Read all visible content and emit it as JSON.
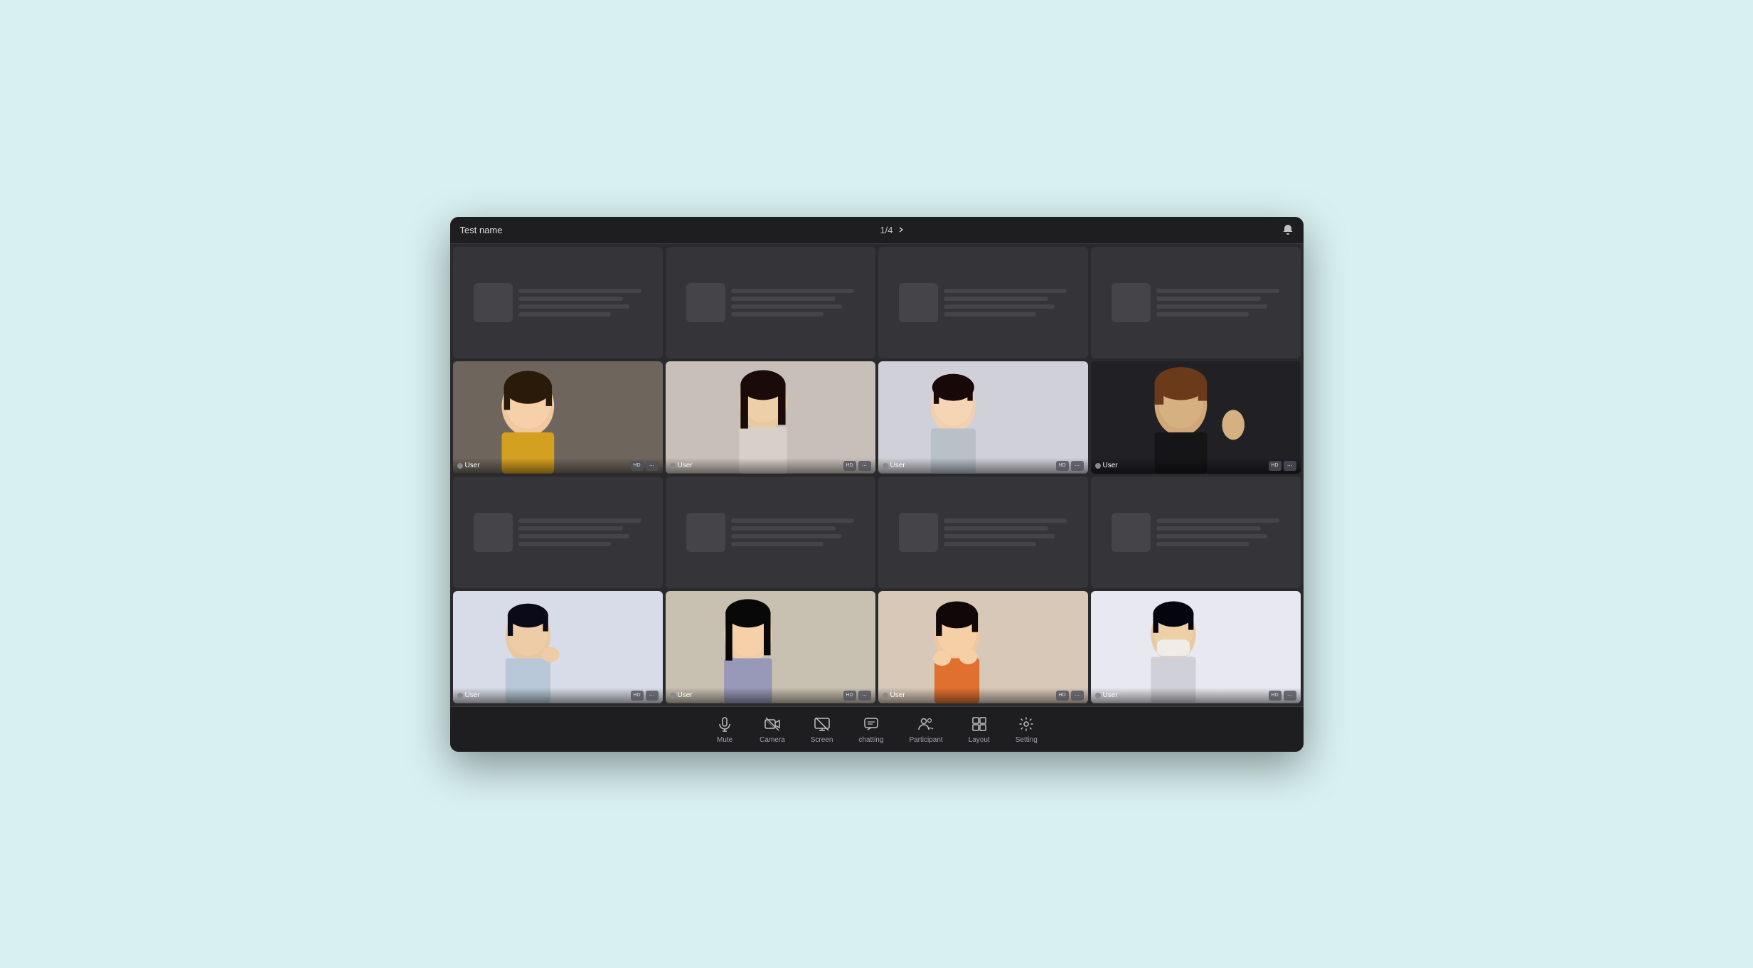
{
  "window": {
    "title": "Test name",
    "pagination": "1/4",
    "notification_icon": "🔔"
  },
  "grid": {
    "rows": 4,
    "cols": 4,
    "cells": [
      {
        "id": 1,
        "has_video": false,
        "row": 0,
        "col": 0
      },
      {
        "id": 2,
        "has_video": false,
        "row": 0,
        "col": 1
      },
      {
        "id": 3,
        "has_video": false,
        "row": 0,
        "col": 2
      },
      {
        "id": 4,
        "has_video": false,
        "row": 0,
        "col": 3
      },
      {
        "id": 5,
        "has_video": true,
        "row": 1,
        "col": 0,
        "user": "User",
        "person_class": "person-1"
      },
      {
        "id": 6,
        "has_video": true,
        "row": 1,
        "col": 1,
        "user": "User",
        "person_class": "person-2"
      },
      {
        "id": 7,
        "has_video": true,
        "row": 1,
        "col": 2,
        "user": "User",
        "person_class": "person-3"
      },
      {
        "id": 8,
        "has_video": true,
        "row": 1,
        "col": 3,
        "user": "User",
        "person_class": "person-4"
      },
      {
        "id": 9,
        "has_video": false,
        "row": 2,
        "col": 0
      },
      {
        "id": 10,
        "has_video": false,
        "row": 2,
        "col": 1
      },
      {
        "id": 11,
        "has_video": false,
        "row": 2,
        "col": 2
      },
      {
        "id": 12,
        "has_video": false,
        "row": 2,
        "col": 3
      },
      {
        "id": 13,
        "has_video": true,
        "row": 3,
        "col": 0,
        "user": "User",
        "person_class": "person-5"
      },
      {
        "id": 14,
        "has_video": true,
        "row": 3,
        "col": 1,
        "user": "User",
        "person_class": "person-6"
      },
      {
        "id": 15,
        "has_video": true,
        "row": 3,
        "col": 2,
        "user": "User",
        "person_class": "person-7"
      },
      {
        "id": 16,
        "has_video": true,
        "row": 3,
        "col": 3,
        "user": "User",
        "person_class": "person-8"
      }
    ]
  },
  "toolbar": {
    "buttons": [
      {
        "id": "mute",
        "label": "Mute",
        "icon": "mute-icon"
      },
      {
        "id": "camera",
        "label": "Camera",
        "icon": "camera-icon"
      },
      {
        "id": "screen",
        "label": "Screen",
        "icon": "screen-icon"
      },
      {
        "id": "chatting",
        "label": "chatting",
        "icon": "chat-icon"
      },
      {
        "id": "participant",
        "label": "Participant",
        "icon": "participant-icon"
      },
      {
        "id": "layout",
        "label": "Layout",
        "icon": "layout-icon"
      },
      {
        "id": "setting",
        "label": "Setting",
        "icon": "setting-icon"
      }
    ]
  },
  "colors": {
    "background": "#d8f0f0",
    "window_bg": "#2a2a2e",
    "titlebar_bg": "#1e1e21",
    "cell_bg": "#353539",
    "toolbar_bg": "#1e1e21",
    "text_primary": "#e0e0e0",
    "text_secondary": "#a0a0a8"
  }
}
